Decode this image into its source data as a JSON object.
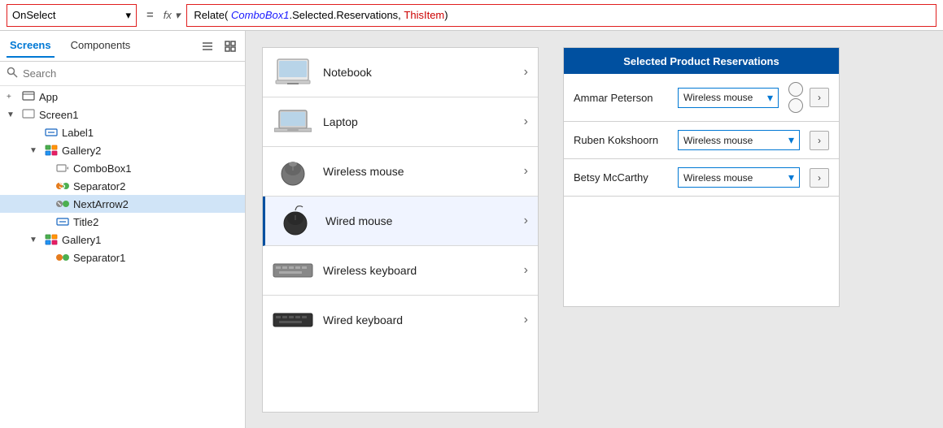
{
  "formulaBar": {
    "property": "OnSelect",
    "dropdownArrow": "▾",
    "equals": "=",
    "fx": "fx",
    "formula": {
      "funcName": "Relate(",
      "arg1": "ComboBox1",
      "arg1b": ".Selected.Reservations,",
      "arg2": "ThisItem",
      "closing": " )"
    }
  },
  "leftPanel": {
    "tabs": [
      {
        "label": "Screens",
        "active": true
      },
      {
        "label": "Components",
        "active": false
      }
    ],
    "searchPlaceholder": "Search",
    "treeItems": [
      {
        "indent": 0,
        "icon": "app",
        "label": "App",
        "arrow": false,
        "hasPlus": true
      },
      {
        "indent": 0,
        "icon": "screen",
        "label": "Screen1",
        "arrow": "down",
        "hasPlus": false
      },
      {
        "indent": 1,
        "icon": "label",
        "label": "Label1",
        "arrow": false,
        "hasPlus": false
      },
      {
        "indent": 1,
        "icon": "gallery",
        "label": "Gallery2",
        "arrow": "down",
        "hasPlus": false
      },
      {
        "indent": 2,
        "icon": "combobox",
        "label": "ComboBox1",
        "arrow": false,
        "hasPlus": false
      },
      {
        "indent": 2,
        "icon": "separator",
        "label": "Separator2",
        "arrow": false,
        "hasPlus": false
      },
      {
        "indent": 2,
        "icon": "nextarrow",
        "label": "NextArrow2",
        "arrow": false,
        "hasPlus": false,
        "selected": true
      },
      {
        "indent": 2,
        "icon": "label",
        "label": "Title2",
        "arrow": false,
        "hasPlus": false
      },
      {
        "indent": 1,
        "icon": "gallery",
        "label": "Gallery1",
        "arrow": "down",
        "hasPlus": false
      },
      {
        "indent": 2,
        "icon": "separator",
        "label": "Separator1",
        "arrow": false,
        "hasPlus": false
      }
    ]
  },
  "productList": {
    "items": [
      {
        "id": 1,
        "name": "Notebook",
        "iconType": "notebook"
      },
      {
        "id": 2,
        "name": "Laptop",
        "iconType": "laptop"
      },
      {
        "id": 3,
        "name": "Wireless mouse",
        "iconType": "wmouse"
      },
      {
        "id": 4,
        "name": "Wired mouse",
        "iconType": "bkmouse",
        "highlight": true
      },
      {
        "id": 5,
        "name": "Wireless keyboard",
        "iconType": "wkbd"
      },
      {
        "id": 6,
        "name": "Wired keyboard",
        "iconType": "bkkbd"
      }
    ]
  },
  "reservations": {
    "title": "Selected Product Reservations",
    "rows": [
      {
        "name": "Ammar Peterson",
        "combo": "Wireless mouse"
      },
      {
        "name": "Ruben Kokshoorn",
        "combo": "Wireless mouse"
      },
      {
        "name": "Betsy McCarthy",
        "combo": "Wireless mouse"
      }
    ]
  }
}
